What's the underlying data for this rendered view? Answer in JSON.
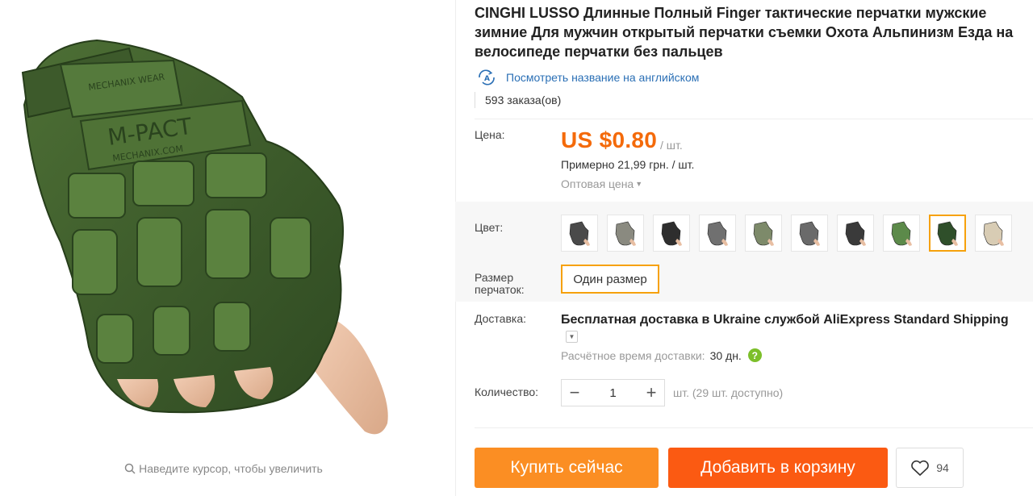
{
  "product": {
    "title": "CINGHI LUSSO Длинные Полный Finger тактические перчатки мужские зимние Для мужчин открытый перчатки съемки Охота Альпинизм Езда на велосипеде перчатки без пальцев",
    "translate_link": "Посмотреть название на английском",
    "orders": "593 заказа(ов)",
    "image_text": {
      "brand_top": "MECHANIX WEAR",
      "brand_pad": "M-PACT",
      "brand_url": "MECHANIX.COM"
    }
  },
  "gallery": {
    "zoom_hint": "Наведите курсор, чтобы увеличить"
  },
  "price": {
    "label": "Цена:",
    "value": "US $0.80",
    "unit": "/ шт.",
    "approx": "Примерно 21,99 грн. / шт.",
    "wholesale": "Оптовая цена"
  },
  "color": {
    "label": "Цвет:",
    "swatches": [
      {
        "name": "swatch-1",
        "color": "#4a4a4a"
      },
      {
        "name": "swatch-2",
        "color": "#8a8a80"
      },
      {
        "name": "swatch-3",
        "color": "#2e2e2e"
      },
      {
        "name": "swatch-4",
        "color": "#707070"
      },
      {
        "name": "swatch-5",
        "color": "#7d8a6a"
      },
      {
        "name": "swatch-6",
        "color": "#6a6a6a"
      },
      {
        "name": "swatch-7",
        "color": "#3a3a3a"
      },
      {
        "name": "swatch-8",
        "color": "#5c8a4a"
      },
      {
        "name": "swatch-9",
        "color": "#2f4f2a"
      },
      {
        "name": "swatch-10",
        "color": "#d8ccb4"
      }
    ],
    "selected_index": 8,
    "selected_border": "#f6a10c"
  },
  "size": {
    "label_line1": "Размер",
    "label_line2": "перчаток:",
    "option": "Один размер"
  },
  "shipping": {
    "label": "Доставка:",
    "main_prefix": "Бесплатная доставка в",
    "main_country": "Ukraine",
    "main_mid": "службой",
    "main_service": "AliExpress Standard Shipping",
    "time_label": "Расчётное время доставки:",
    "days": "30 дн."
  },
  "quantity": {
    "label": "Количество:",
    "minus": "−",
    "value": "1",
    "plus": "+",
    "note": "шт. (29 шт. доступно)"
  },
  "actions": {
    "buy_now": "Купить сейчас",
    "add_to_cart": "Добавить в корзину",
    "wishlist_count": "94"
  },
  "colors": {
    "price": "#f46a0a",
    "link": "#2a6fb5",
    "buy": "#fb8e23",
    "cart": "#fb5a12",
    "glove": "#3f5f2a"
  }
}
